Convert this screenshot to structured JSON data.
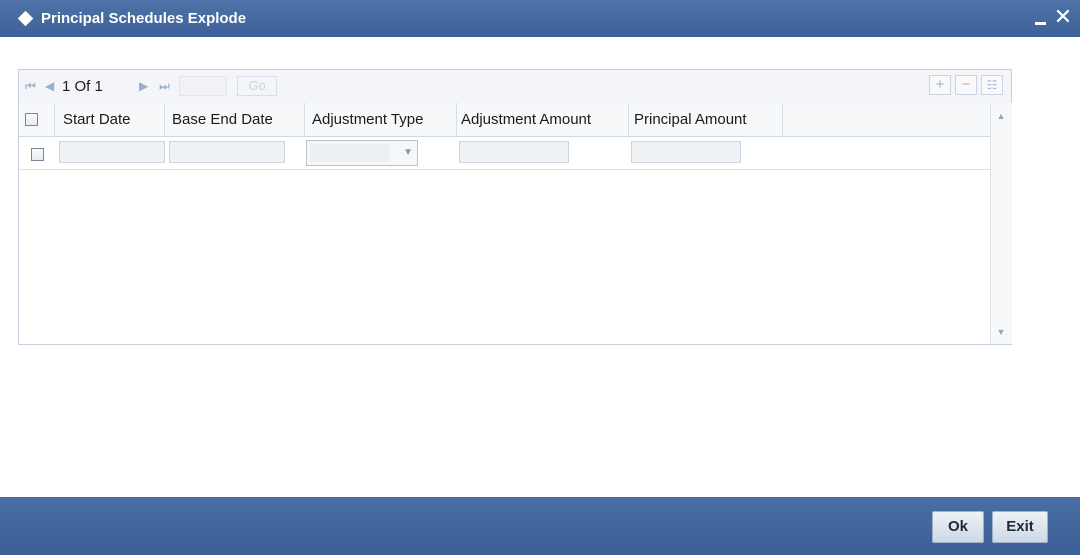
{
  "window": {
    "title": "Principal Schedules Explode",
    "minimize_icon": "minimize-icon",
    "close_glyph": "✕"
  },
  "toolbar": {
    "first_glyph": "⏮",
    "prev_glyph": "◀",
    "page_label": "1 Of 1",
    "next_glyph": "▶",
    "last_glyph": "⏭",
    "go_label": "Go",
    "add_glyph": "+",
    "delete_glyph": "−",
    "detail_glyph": "☷"
  },
  "grid": {
    "columns": [
      "Start Date",
      "Base End Date",
      "Adjustment Type",
      "Adjustment Amount",
      "Principal Amount"
    ],
    "rows": [
      {
        "start_date": "",
        "base_end_date": "",
        "adjustment_type": "",
        "adjustment_amount": "",
        "principal_amount": ""
      }
    ]
  },
  "scrollbar": {
    "up_glyph": "▲",
    "down_glyph": "▼"
  },
  "footer": {
    "ok_label": "Ok",
    "exit_label": "Exit"
  },
  "colors": {
    "title_bar": "#4467a0",
    "footer_bar": "#4266a0"
  }
}
